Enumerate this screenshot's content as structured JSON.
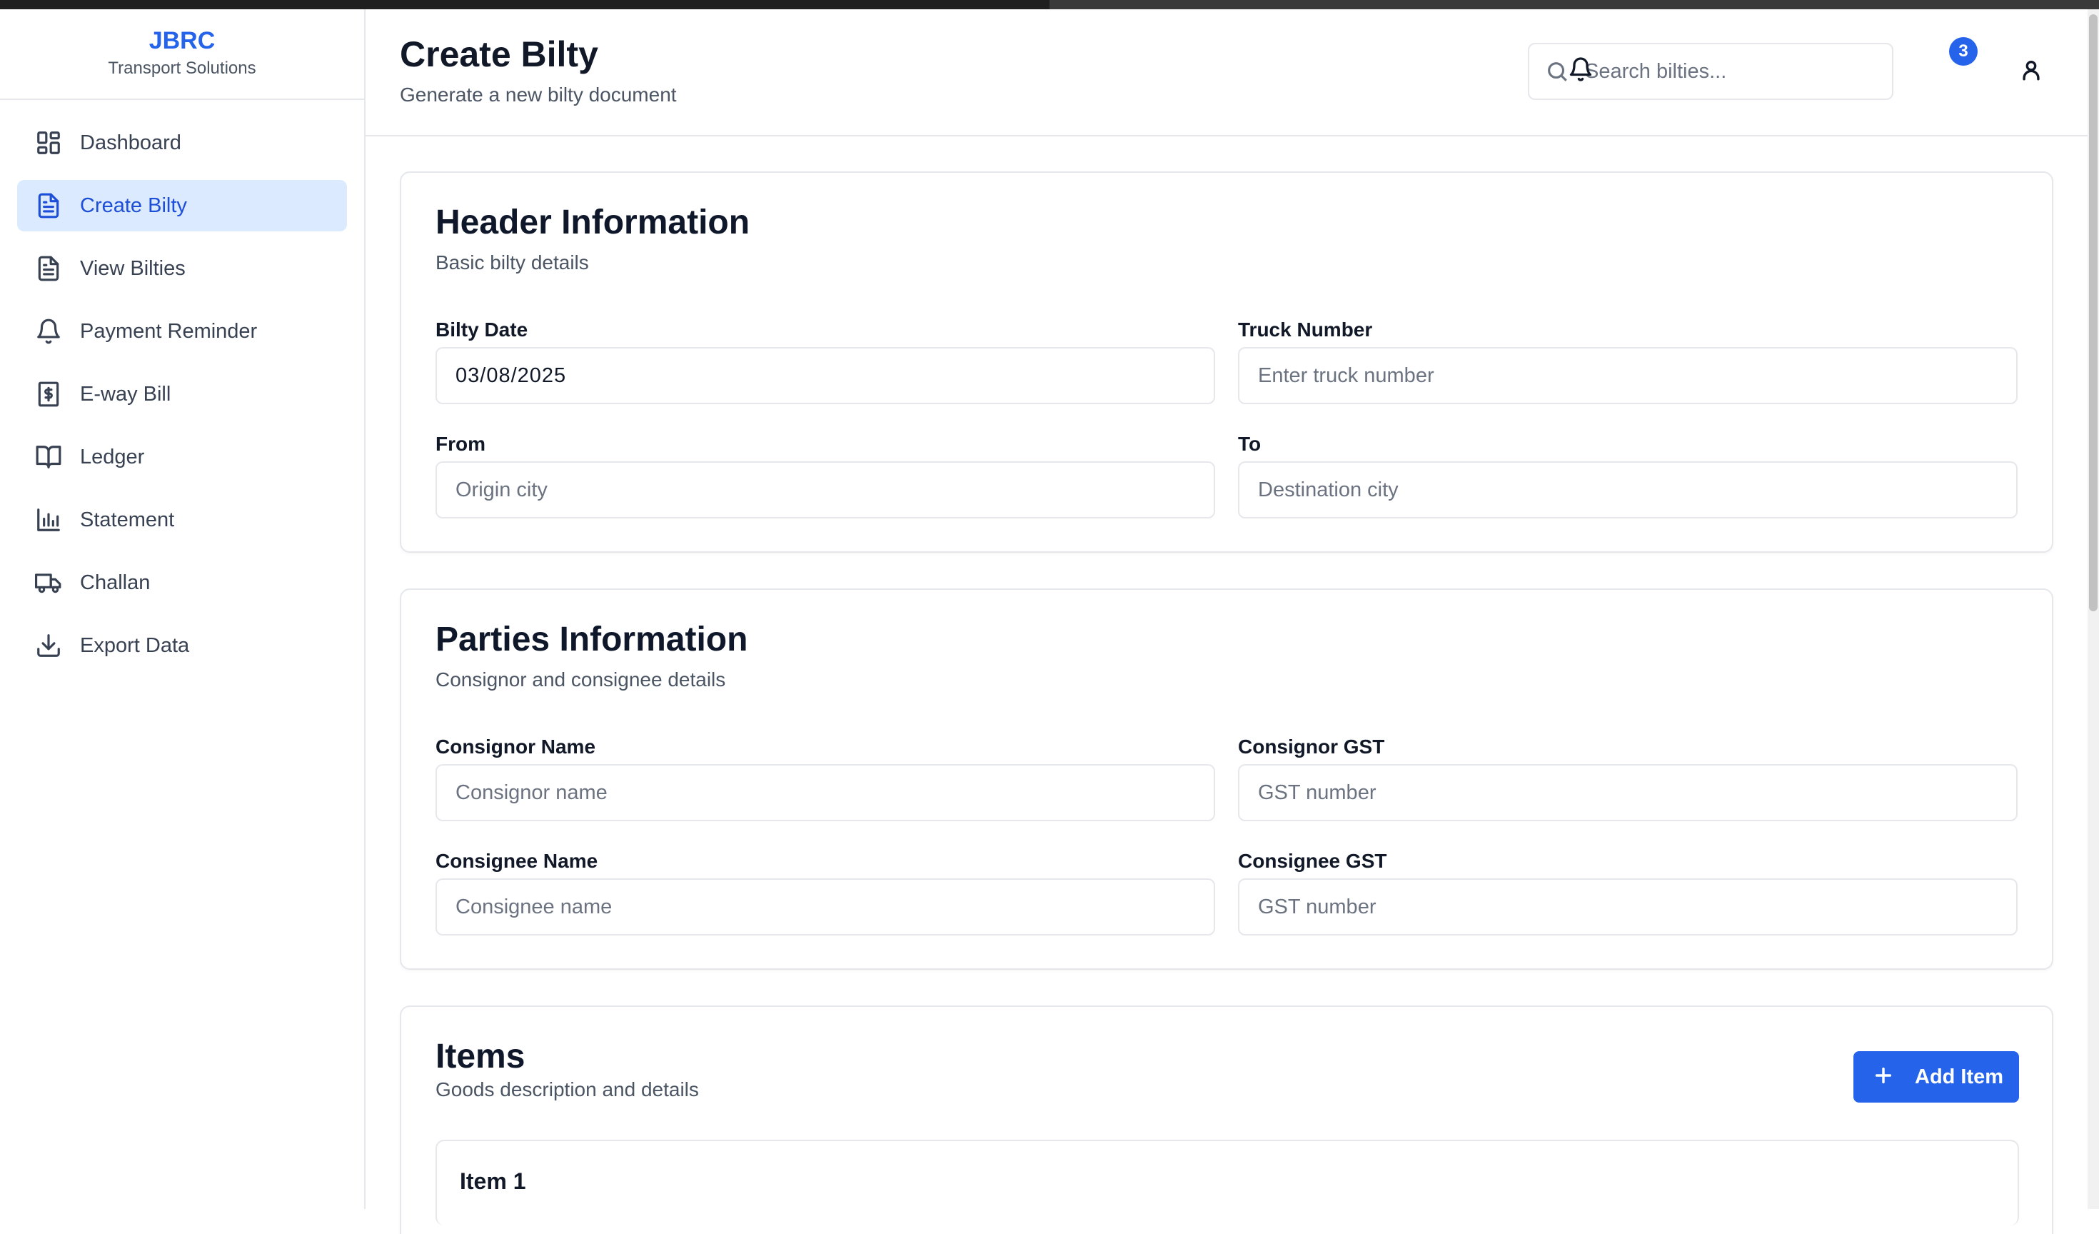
{
  "brand": {
    "name": "JBRC",
    "subtitle": "Transport Solutions"
  },
  "sidebar": {
    "items": [
      {
        "label": "Dashboard",
        "icon": "dashboard-icon",
        "active": false
      },
      {
        "label": "Create Bilty",
        "icon": "file-text-icon",
        "active": true
      },
      {
        "label": "View Bilties",
        "icon": "file-text-icon",
        "active": false
      },
      {
        "label": "Payment Reminder",
        "icon": "bell-icon",
        "active": false
      },
      {
        "label": "E-way Bill",
        "icon": "receipt-icon",
        "active": false
      },
      {
        "label": "Ledger",
        "icon": "book-open-icon",
        "active": false
      },
      {
        "label": "Statement",
        "icon": "bar-chart-icon",
        "active": false
      },
      {
        "label": "Challan",
        "icon": "truck-icon",
        "active": false
      },
      {
        "label": "Export Data",
        "icon": "download-icon",
        "active": false
      }
    ]
  },
  "header": {
    "title": "Create Bilty",
    "subtitle": "Generate a new bilty document",
    "search_placeholder": "Search bilties...",
    "notification_count": "3"
  },
  "sections": {
    "header_info": {
      "title": "Header Information",
      "subtitle": "Basic bilty details",
      "bilty_date_label": "Bilty Date",
      "bilty_date_value": "03/08/2025",
      "truck_number_label": "Truck Number",
      "truck_number_placeholder": "Enter truck number",
      "from_label": "From",
      "from_placeholder": "Origin city",
      "to_label": "To",
      "to_placeholder": "Destination city"
    },
    "parties_info": {
      "title": "Parties Information",
      "subtitle": "Consignor and consignee details",
      "consignor_name_label": "Consignor Name",
      "consignor_name_placeholder": "Consignor name",
      "consignor_gst_label": "Consignor GST",
      "consignor_gst_placeholder": "GST number",
      "consignee_name_label": "Consignee Name",
      "consignee_name_placeholder": "Consignee name",
      "consignee_gst_label": "Consignee GST",
      "consignee_gst_placeholder": "GST number"
    },
    "items": {
      "title": "Items",
      "subtitle": "Goods description and details",
      "add_button_label": "Add Item",
      "item_titles": [
        "Item 1"
      ]
    }
  },
  "colors": {
    "accent": "#2563eb",
    "active_bg": "#dbeafe",
    "active_text": "#1d4ed8",
    "border": "#e5e7eb"
  }
}
